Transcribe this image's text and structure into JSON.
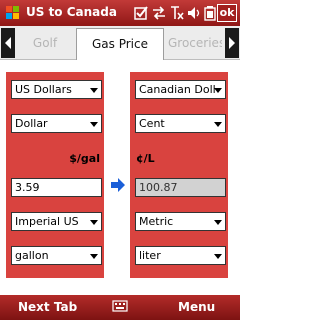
{
  "window": {
    "title": "US to Canada",
    "ok_label": "ok"
  },
  "tabs": [
    {
      "label": "Golf",
      "active": false
    },
    {
      "label": "Gas Price",
      "active": true
    },
    {
      "label": "Groceries",
      "active": false
    }
  ],
  "left_panel": {
    "currency": "US Dollars",
    "denomination": "Dollar",
    "unit_label": "$/gal",
    "value": "3.59",
    "system": "Imperial US",
    "volume": "gallon"
  },
  "right_panel": {
    "currency": "Canadian Dollar",
    "denomination": "Cent",
    "unit_label": "¢/L",
    "value": "100.87",
    "system": "Metric",
    "volume": "liter"
  },
  "softkeys": {
    "left": "Next Tab",
    "right": "Menu"
  },
  "colors": {
    "titlebar": "#a8221f",
    "panel": "#d9433f",
    "arrow": "#1b5fd8"
  }
}
